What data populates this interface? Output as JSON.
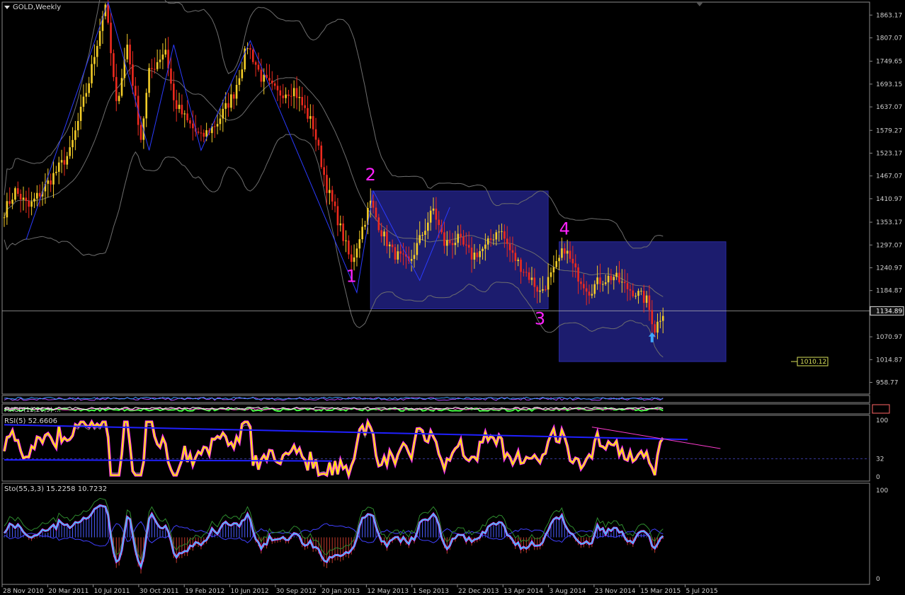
{
  "window": {
    "symbol_title": "GOLD,Weekly"
  },
  "colors": {
    "background": "#000000",
    "axis_text": "#cfcfcf",
    "grid_border": "#8a8a8a",
    "bull_candle": "#f4cd28",
    "bear_candle": "#ee2a1e",
    "bands": "#6e6e6e",
    "wave_line": "#2b3bff",
    "wave_labels": "#ff22ff",
    "range_box": "#1c1c6e",
    "price_line": "#bbbbbb",
    "price_label_bg": "#000000",
    "target_label": "#d8e15a",
    "rsi_main": "#ffee00",
    "rsi_shadow": "#ff33ff",
    "stoch_main": "#22d8ff",
    "stoch_signal": "#ff33ff",
    "hist_up": "#4b5cff",
    "hist_down": "#c0392b",
    "trend_blue": "#2020ff",
    "trend_magenta": "#ff3ccf"
  },
  "chart_data": [
    {
      "type": "candlestick",
      "pane": "main",
      "title": "GOLD,Weekly",
      "ylim": [
        930,
        1895
      ],
      "y_ticks": [
        "1863.17",
        "1807.07",
        "1749.65",
        "1693.15",
        "1637.07",
        "1579.27",
        "1523.17",
        "1467.07",
        "1410.97",
        "1353.17",
        "1297.07",
        "1240.97",
        "1184.87",
        "1070.97",
        "1014.87",
        "958.77"
      ],
      "y_tick_values": [
        1863.17,
        1807.07,
        1749.65,
        1693.15,
        1637.07,
        1579.27,
        1523.17,
        1467.07,
        1410.97,
        1353.17,
        1297.07,
        1240.97,
        1184.87,
        1070.97,
        1014.87,
        958.77
      ],
      "x_ticks": [
        "28 Nov 2010",
        "20 Mar 2011",
        "10 Jul 2011",
        "30 Oct 2011",
        "19 Feb 2012",
        "10 Jun 2012",
        "30 Sep 2012",
        "20 Jan 2013",
        "12 May 2013",
        "1 Sep 2013",
        "22 Dec 2013",
        "13 Apr 2014",
        "3 Aug 2014",
        "23 Nov 2014",
        "15 Mar 2015",
        "5 Jul 2015"
      ],
      "path_points": [
        {
          "w": 0,
          "p": 1380
        },
        {
          "w": 4,
          "p": 1430
        },
        {
          "w": 9,
          "p": 1390
        },
        {
          "w": 16,
          "p": 1450
        },
        {
          "w": 24,
          "p": 1525
        },
        {
          "w": 31,
          "p": 1700
        },
        {
          "w": 37,
          "p": 1895
        },
        {
          "w": 41,
          "p": 1640
        },
        {
          "w": 45,
          "p": 1790
        },
        {
          "w": 50,
          "p": 1560
        },
        {
          "w": 53,
          "p": 1720
        },
        {
          "w": 59,
          "p": 1780
        },
        {
          "w": 62,
          "p": 1650
        },
        {
          "w": 67,
          "p": 1600
        },
        {
          "w": 72,
          "p": 1560
        },
        {
          "w": 78,
          "p": 1600
        },
        {
          "w": 84,
          "p": 1670
        },
        {
          "w": 89,
          "p": 1790
        },
        {
          "w": 94,
          "p": 1710
        },
        {
          "w": 100,
          "p": 1670
        },
        {
          "w": 106,
          "p": 1680
        },
        {
          "w": 113,
          "p": 1590
        },
        {
          "w": 118,
          "p": 1440
        },
        {
          "w": 122,
          "p": 1360
        },
        {
          "w": 127,
          "p": 1250
        },
        {
          "w": 130,
          "p": 1320
        },
        {
          "w": 134,
          "p": 1400
        },
        {
          "w": 138,
          "p": 1330
        },
        {
          "w": 142,
          "p": 1280
        },
        {
          "w": 148,
          "p": 1250
        },
        {
          "w": 154,
          "p": 1340
        },
        {
          "w": 157,
          "p": 1385
        },
        {
          "w": 161,
          "p": 1300
        },
        {
          "w": 166,
          "p": 1310
        },
        {
          "w": 171,
          "p": 1270
        },
        {
          "w": 176,
          "p": 1290
        },
        {
          "w": 181,
          "p": 1340
        },
        {
          "w": 186,
          "p": 1270
        },
        {
          "w": 192,
          "p": 1220
        },
        {
          "w": 196,
          "p": 1180
        },
        {
          "w": 201,
          "p": 1230
        },
        {
          "w": 205,
          "p": 1290
        },
        {
          "w": 209,
          "p": 1230
        },
        {
          "w": 214,
          "p": 1185
        },
        {
          "w": 218,
          "p": 1210
        },
        {
          "w": 223,
          "p": 1220
        },
        {
          "w": 227,
          "p": 1195
        },
        {
          "w": 231,
          "p": 1180
        },
        {
          "w": 235,
          "p": 1160
        },
        {
          "w": 238,
          "p": 1090
        },
        {
          "w": 241,
          "p": 1135
        }
      ],
      "current_price": "1134.89",
      "target_price": "1010.12",
      "wave_labels": [
        {
          "text": "1",
          "w": 127,
          "p": 1250
        },
        {
          "text": "2",
          "w": 134,
          "p": 1430
        },
        {
          "text": "3",
          "w": 196,
          "p": 1180
        },
        {
          "text": "4",
          "w": 205,
          "p": 1297
        }
      ],
      "range_boxes": [
        {
          "w_start": 134,
          "w_end": 199,
          "p_top": 1430,
          "p_bottom": 1140
        },
        {
          "w_start": 203,
          "w_end": 264,
          "p_top": 1305,
          "p_bottom": 1010
        }
      ],
      "zigzag_points": [
        {
          "w": 8,
          "p": 1310
        },
        {
          "w": 38,
          "p": 1895
        },
        {
          "w": 53,
          "p": 1530
        },
        {
          "w": 62,
          "p": 1790
        },
        {
          "w": 72,
          "p": 1530
        },
        {
          "w": 90,
          "p": 1800
        },
        {
          "w": 129,
          "p": 1180
        },
        {
          "w": 135,
          "p": 1430
        },
        {
          "w": 152,
          "p": 1210
        },
        {
          "w": 163,
          "p": 1390
        }
      ]
    },
    {
      "type": "line",
      "pane": "macd",
      "label": "MACD(12,26,9) ..."
    },
    {
      "type": "line",
      "pane": "rsi",
      "title": "RSI(5) 52.6606",
      "ylim": [
        0,
        100
      ],
      "y_ticks": [
        "100",
        "32",
        "0"
      ],
      "y_tick_values": [
        100,
        32,
        0
      ]
    },
    {
      "type": "line",
      "pane": "stochastic",
      "title": "Sto(55,3,3) 15.2258 10.7232",
      "ylim": [
        0,
        100
      ],
      "y_ticks": [
        "100",
        "0"
      ],
      "y_tick_values": [
        100,
        0
      ]
    }
  ]
}
